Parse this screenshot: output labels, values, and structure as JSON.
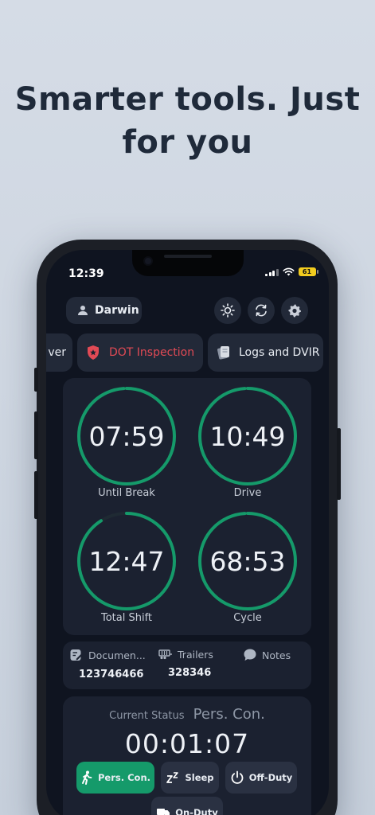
{
  "headline": {
    "line1": "Smarter tools. Just",
    "line2": "for you"
  },
  "status_bar": {
    "time": "12:39",
    "battery": "61"
  },
  "header": {
    "user_name": "Darwin"
  },
  "tabs": [
    {
      "label": "ver"
    },
    {
      "label": "DOT  Inspection"
    },
    {
      "label": "Logs and DVIR"
    }
  ],
  "timers": [
    {
      "value": "07:59",
      "label": "Until Break",
      "progress": 0.99
    },
    {
      "value": "10:49",
      "label": "Drive",
      "progress": 0.99
    },
    {
      "value": "12:47",
      "label": "Total Shift",
      "progress": 0.91
    },
    {
      "value": "68:53",
      "label": "Cycle",
      "progress": 0.99
    }
  ],
  "info": {
    "documents_label": "Documen...",
    "documents_value": "123746466",
    "trailers_label": "Trailers",
    "trailers_value": "328346",
    "notes_label": "Notes"
  },
  "current_status": {
    "label": "Current Status",
    "value": "Pers. Con.",
    "timer": "00:01:07"
  },
  "duty_buttons": {
    "pers_con": "Pers. Con.",
    "sleep": "Sleep",
    "off_duty": "Off-Duty",
    "on_duty": "On-Duty"
  },
  "colors": {
    "ring": "#159a6a",
    "ring_track": "#1f2a33",
    "accent_red": "#e24a55",
    "active_green": "#159a6a"
  }
}
